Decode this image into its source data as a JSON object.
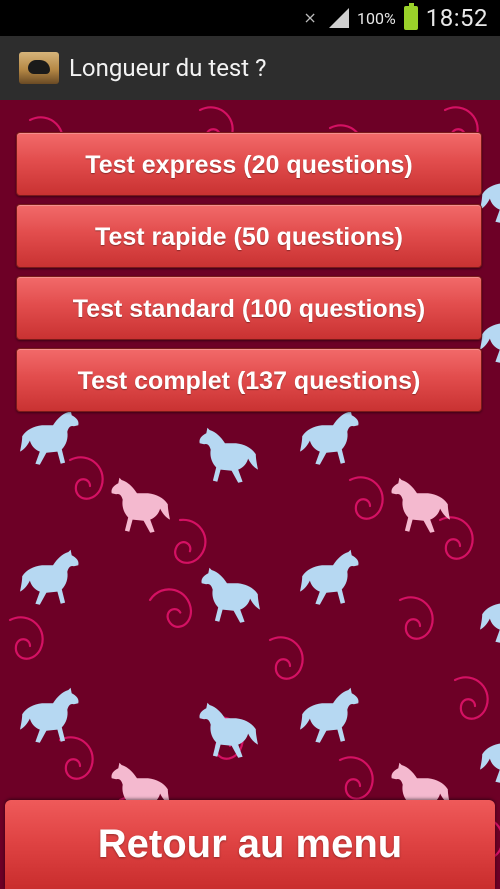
{
  "status_bar": {
    "battery_percent": "100%",
    "time": "18:52",
    "icons": [
      "mute-icon",
      "signal-icon",
      "battery-icon"
    ]
  },
  "action_bar": {
    "title": "Longueur du test ?",
    "icon": "horse-app-icon"
  },
  "tests": [
    {
      "label": "Test express (20 questions)"
    },
    {
      "label": "Test rapide (50 questions)"
    },
    {
      "label": "Test standard (100 questions)"
    },
    {
      "label": "Test complet (137 questions)"
    }
  ],
  "back_button": {
    "label": "Retour au menu"
  },
  "colors": {
    "background": "#6d0026",
    "button_red": "#e24d4d",
    "horse_blue": "#b6d8f2",
    "horse_pink": "#f4b9cf",
    "swirl_pink": "#e0136a"
  }
}
